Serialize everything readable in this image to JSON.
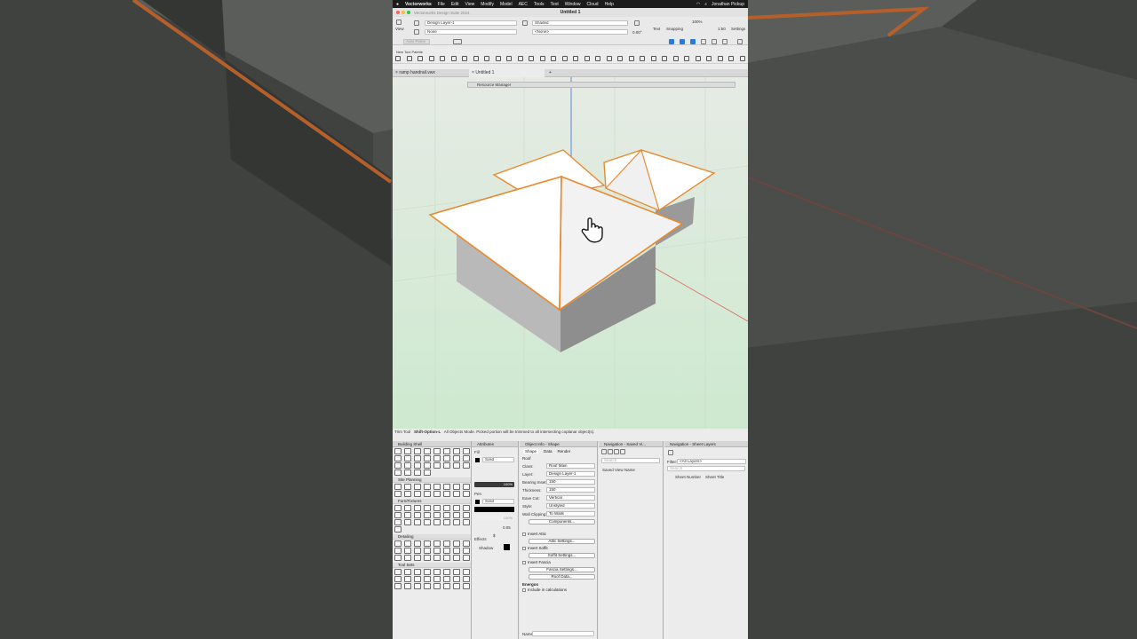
{
  "menubar": {
    "app": "Vectorworks",
    "items": [
      "File",
      "Edit",
      "View",
      "Modify",
      "Model",
      "AEC",
      "Tools",
      "Text",
      "Window",
      "Cloud",
      "Help"
    ],
    "user": "Jonathan Pickup"
  },
  "titlebar": {
    "app_version": "Vectorworks Design Suite 2024",
    "doc_title": "Untitled 1"
  },
  "viewbar": {
    "view_label": "View",
    "layer": "Design Layer-1",
    "class": "None",
    "render_mode": "Shaded",
    "view_none": "<None>",
    "zoom": "100%",
    "angle": "0.00°",
    "scale": "1:50",
    "text_label": "Text",
    "snapping_label": "Snapping",
    "settings_label": "Settings",
    "auto_plane": "Auto Plane"
  },
  "tool_palette": {
    "title": "New Tool Palette"
  },
  "tabs": [
    "ramp handrail.vwx",
    "Untitled 1"
  ],
  "resource_manager": {
    "title": "Resource Manager"
  },
  "status": {
    "tool": "Trim Tool",
    "shortcut": "Shift-Option-L",
    "message": "All Objects Mode. Picked portion will be trimmed to all intersecting coplanar object(s)."
  },
  "palettes": {
    "toolsets": {
      "title": "Building Shell",
      "sections": [
        "Site Planning",
        "Furn/Fixtures",
        "Detailing",
        "Tool Sets"
      ]
    },
    "attributes": {
      "title": "Attributes",
      "fill_label": "Fill",
      "fill_style": "Solid",
      "opacity": "100%",
      "pen_label": "Pen",
      "pen_style": "Solid",
      "pen_opacity": "100%",
      "line_weight": "0.05",
      "effects_label": "Effects",
      "shadow_label": "Shadow"
    },
    "object_info": {
      "title": "Object Info - Shape",
      "tabs": [
        "Shape",
        "Data",
        "Render"
      ],
      "object_type": "Roof",
      "fields": [
        {
          "k": "Class:",
          "v": "Roof Main"
        },
        {
          "k": "Layer:",
          "v": "Design Layer-1"
        },
        {
          "k": "Bearing Inset:",
          "v": "150"
        },
        {
          "k": "Thickness:",
          "v": "150"
        },
        {
          "k": "Eave Cut:",
          "v": "Vertical"
        },
        {
          "k": "Style:",
          "v": "Unstyled"
        },
        {
          "k": "Wall Clipping:",
          "v": "To Walls"
        }
      ],
      "components_btn": "Components...",
      "insert_attic": "Insert Attic",
      "attic_btn": "Attic Settings...",
      "insert_soffit": "Insert Soffit",
      "soffit_btn": "Soffit Settings...",
      "insert_fascia": "Insert Fascia",
      "fascia_btn": "Fascia Settings...",
      "roof_data_btn": "Roof Data...",
      "energos": "Energos",
      "include_calc": "Include in calculations",
      "name_label": "Name"
    },
    "saved_views": {
      "title": "Navigation - Saved Vi...",
      "search_placeholder": "Search",
      "col": "Saved View Name"
    },
    "sheet_layers": {
      "title": "Navigation - Sheet Layers",
      "filter_label": "Filter:",
      "filter_value": "<All Layers>",
      "search_placeholder": "Search",
      "cols": [
        "Sheet Number",
        "Sheet Title"
      ]
    }
  },
  "colors": {
    "accent": "#2a7bd6",
    "highlight": "#e8892e",
    "canvas": "#d4ecd5"
  }
}
